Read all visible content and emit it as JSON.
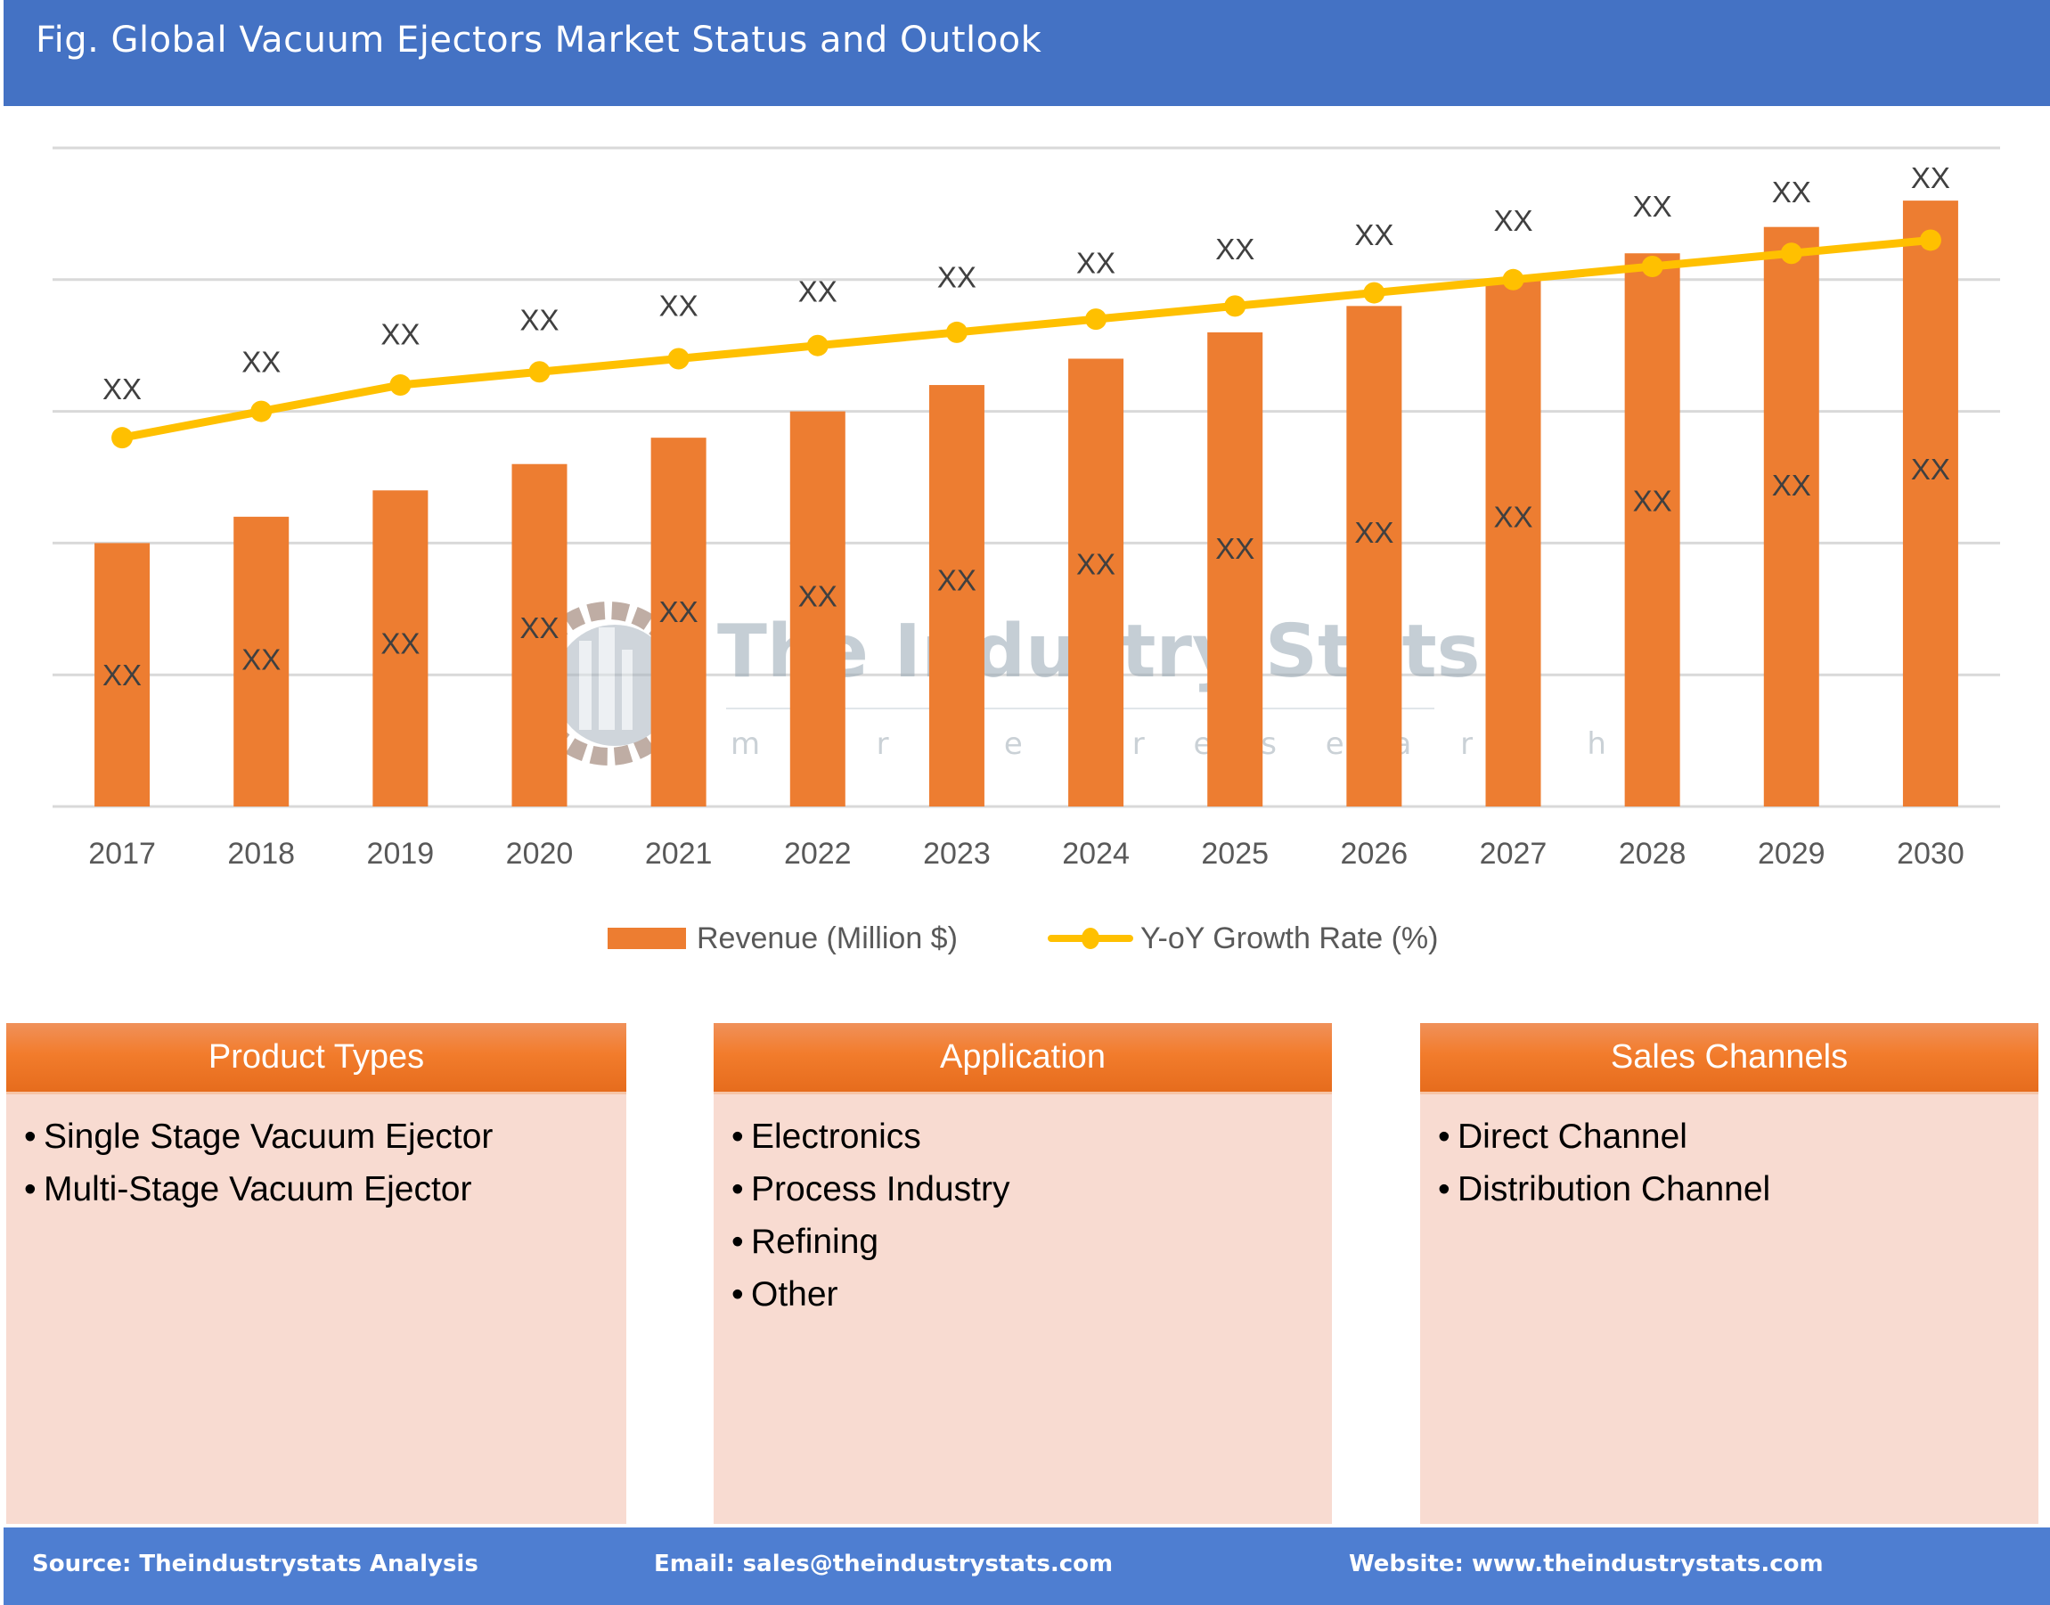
{
  "header": {
    "title": "Fig. Global Vacuum Ejectors Market Status and Outlook"
  },
  "colors": {
    "banner": "#4472c4",
    "bar": "#ed7d31",
    "line": "#ffc000",
    "panel_bg": "#f8dbd1",
    "footer": "#4e7ed1"
  },
  "chart_data": {
    "type": "bar+line",
    "title": "Fig. Global Vacuum Ejectors Market Status and Outlook",
    "xlabel": "",
    "ylabel": "",
    "categories": [
      "2017",
      "2018",
      "2019",
      "2020",
      "2021",
      "2022",
      "2023",
      "2024",
      "2025",
      "2026",
      "2027",
      "2028",
      "2029",
      "2030"
    ],
    "series": [
      {
        "name": "Revenue (Million $)",
        "type": "bar",
        "values": [
          2.0,
          2.2,
          2.4,
          2.6,
          2.8,
          3.0,
          3.2,
          3.4,
          3.6,
          3.8,
          4.0,
          4.2,
          4.4,
          4.6
        ],
        "data_labels": [
          "XX",
          "XX",
          "XX",
          "XX",
          "XX",
          "XX",
          "XX",
          "XX",
          "XX",
          "XX",
          "XX",
          "XX",
          "XX",
          "XX"
        ]
      },
      {
        "name": "Y-oY Growth Rate (%)",
        "type": "line",
        "values": [
          2.8,
          3.0,
          3.2,
          3.3,
          3.4,
          3.5,
          3.6,
          3.7,
          3.8,
          3.9,
          4.0,
          4.1,
          4.2,
          4.3
        ],
        "data_labels": [
          "XX",
          "XX",
          "XX",
          "XX",
          "XX",
          "XX",
          "XX",
          "XX",
          "XX",
          "XX",
          "XX",
          "XX",
          "XX",
          "XX"
        ]
      }
    ],
    "ylim": [
      0,
      5
    ],
    "y_tick_labels_visible": false,
    "grid": true,
    "legend": "bottom",
    "watermark": {
      "title": "The Industry Stats",
      "subtitle": "m a r k e t   r e s e a r c h"
    }
  },
  "panels": [
    {
      "title": "Product Types",
      "items": [
        "Single Stage Vacuum Ejector",
        "Multi-Stage Vacuum Ejector"
      ]
    },
    {
      "title": "Application",
      "items": [
        "Electronics",
        "Process Industry",
        "Refining",
        "Other"
      ]
    },
    {
      "title": "Sales Channels",
      "items": [
        "Direct Channel",
        "Distribution Channel"
      ]
    }
  ],
  "bullet": "•",
  "footer": {
    "source": "Source: Theindustrystats Analysis",
    "email": "Email: sales@theindustrystats.com",
    "website": "Website: www.theindustrystats.com"
  }
}
